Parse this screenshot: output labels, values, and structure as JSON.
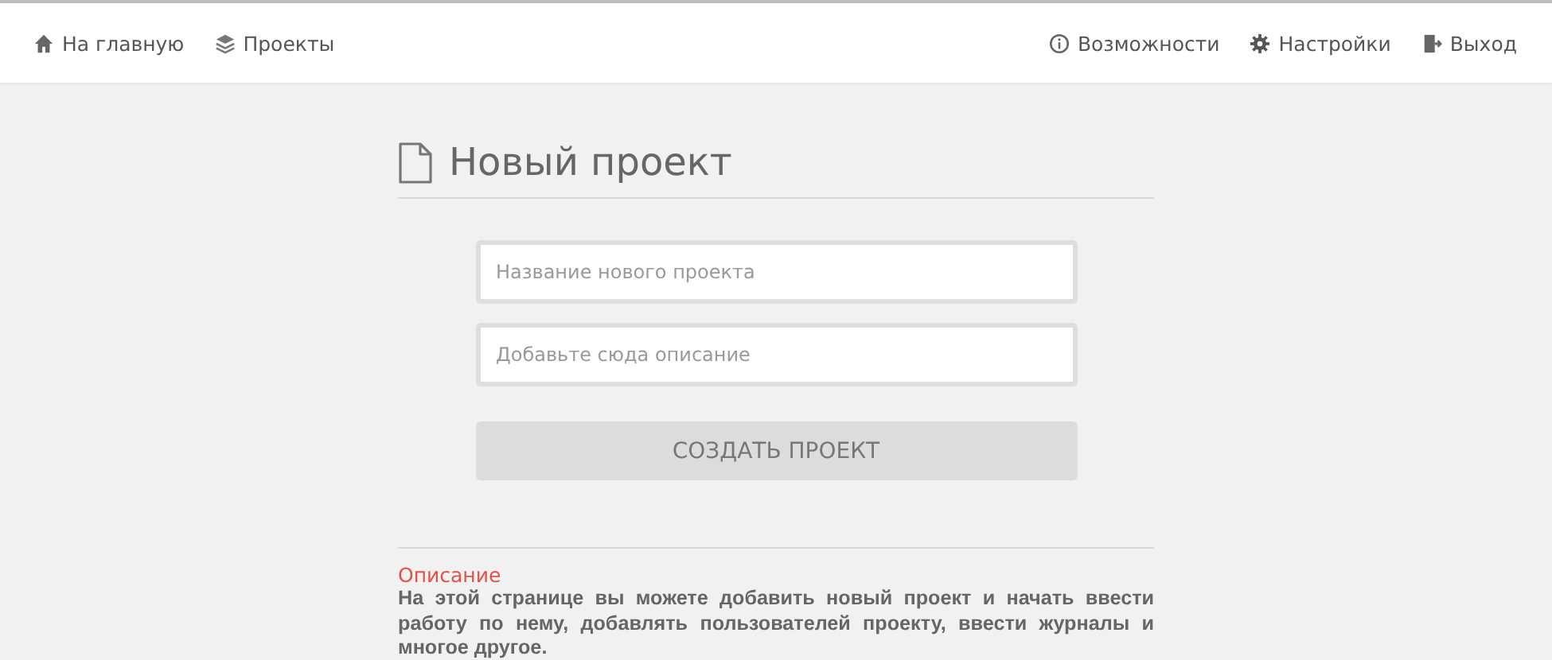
{
  "navbar": {
    "left": [
      {
        "label": "На главную",
        "kind": "home"
      },
      {
        "label": "Проекты",
        "kind": "layers"
      }
    ],
    "right": [
      {
        "label": "Возможности",
        "kind": "info"
      },
      {
        "label": "Настройки",
        "kind": "gear"
      },
      {
        "label": "Выход",
        "kind": "exit"
      }
    ]
  },
  "page": {
    "title": "Новый проект",
    "fields": [
      {
        "placeholder": "Название нового проекта"
      },
      {
        "placeholder": "Добавьте сюда описание"
      }
    ],
    "submit": {
      "label": "СОЗДАТЬ ПРОЕКТ",
      "disabled": true
    },
    "info": {
      "heading": "Описание",
      "text": "На этой странице вы можете добавить новый проект и начать ввести работу по нему, добавлять пользователей проекту, ввести журналы и многое другое."
    }
  }
}
